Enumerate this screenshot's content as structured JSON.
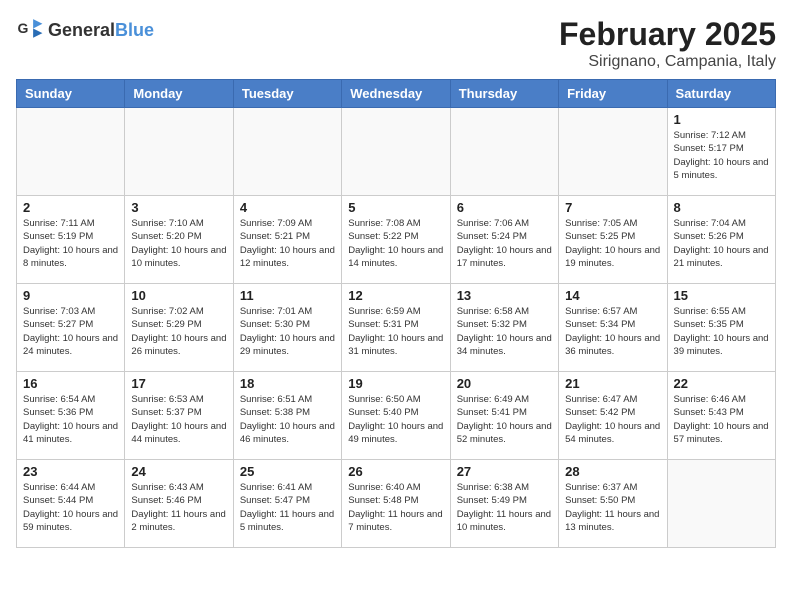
{
  "logo": {
    "general": "General",
    "blue": "Blue"
  },
  "title": "February 2025",
  "subtitle": "Sirignano, Campania, Italy",
  "weekdays": [
    "Sunday",
    "Monday",
    "Tuesday",
    "Wednesday",
    "Thursday",
    "Friday",
    "Saturday"
  ],
  "weeks": [
    [
      {
        "day": "",
        "info": ""
      },
      {
        "day": "",
        "info": ""
      },
      {
        "day": "",
        "info": ""
      },
      {
        "day": "",
        "info": ""
      },
      {
        "day": "",
        "info": ""
      },
      {
        "day": "",
        "info": ""
      },
      {
        "day": "1",
        "info": "Sunrise: 7:12 AM\nSunset: 5:17 PM\nDaylight: 10 hours and 5 minutes."
      }
    ],
    [
      {
        "day": "2",
        "info": "Sunrise: 7:11 AM\nSunset: 5:19 PM\nDaylight: 10 hours and 8 minutes."
      },
      {
        "day": "3",
        "info": "Sunrise: 7:10 AM\nSunset: 5:20 PM\nDaylight: 10 hours and 10 minutes."
      },
      {
        "day": "4",
        "info": "Sunrise: 7:09 AM\nSunset: 5:21 PM\nDaylight: 10 hours and 12 minutes."
      },
      {
        "day": "5",
        "info": "Sunrise: 7:08 AM\nSunset: 5:22 PM\nDaylight: 10 hours and 14 minutes."
      },
      {
        "day": "6",
        "info": "Sunrise: 7:06 AM\nSunset: 5:24 PM\nDaylight: 10 hours and 17 minutes."
      },
      {
        "day": "7",
        "info": "Sunrise: 7:05 AM\nSunset: 5:25 PM\nDaylight: 10 hours and 19 minutes."
      },
      {
        "day": "8",
        "info": "Sunrise: 7:04 AM\nSunset: 5:26 PM\nDaylight: 10 hours and 21 minutes."
      }
    ],
    [
      {
        "day": "9",
        "info": "Sunrise: 7:03 AM\nSunset: 5:27 PM\nDaylight: 10 hours and 24 minutes."
      },
      {
        "day": "10",
        "info": "Sunrise: 7:02 AM\nSunset: 5:29 PM\nDaylight: 10 hours and 26 minutes."
      },
      {
        "day": "11",
        "info": "Sunrise: 7:01 AM\nSunset: 5:30 PM\nDaylight: 10 hours and 29 minutes."
      },
      {
        "day": "12",
        "info": "Sunrise: 6:59 AM\nSunset: 5:31 PM\nDaylight: 10 hours and 31 minutes."
      },
      {
        "day": "13",
        "info": "Sunrise: 6:58 AM\nSunset: 5:32 PM\nDaylight: 10 hours and 34 minutes."
      },
      {
        "day": "14",
        "info": "Sunrise: 6:57 AM\nSunset: 5:34 PM\nDaylight: 10 hours and 36 minutes."
      },
      {
        "day": "15",
        "info": "Sunrise: 6:55 AM\nSunset: 5:35 PM\nDaylight: 10 hours and 39 minutes."
      }
    ],
    [
      {
        "day": "16",
        "info": "Sunrise: 6:54 AM\nSunset: 5:36 PM\nDaylight: 10 hours and 41 minutes."
      },
      {
        "day": "17",
        "info": "Sunrise: 6:53 AM\nSunset: 5:37 PM\nDaylight: 10 hours and 44 minutes."
      },
      {
        "day": "18",
        "info": "Sunrise: 6:51 AM\nSunset: 5:38 PM\nDaylight: 10 hours and 46 minutes."
      },
      {
        "day": "19",
        "info": "Sunrise: 6:50 AM\nSunset: 5:40 PM\nDaylight: 10 hours and 49 minutes."
      },
      {
        "day": "20",
        "info": "Sunrise: 6:49 AM\nSunset: 5:41 PM\nDaylight: 10 hours and 52 minutes."
      },
      {
        "day": "21",
        "info": "Sunrise: 6:47 AM\nSunset: 5:42 PM\nDaylight: 10 hours and 54 minutes."
      },
      {
        "day": "22",
        "info": "Sunrise: 6:46 AM\nSunset: 5:43 PM\nDaylight: 10 hours and 57 minutes."
      }
    ],
    [
      {
        "day": "23",
        "info": "Sunrise: 6:44 AM\nSunset: 5:44 PM\nDaylight: 10 hours and 59 minutes."
      },
      {
        "day": "24",
        "info": "Sunrise: 6:43 AM\nSunset: 5:46 PM\nDaylight: 11 hours and 2 minutes."
      },
      {
        "day": "25",
        "info": "Sunrise: 6:41 AM\nSunset: 5:47 PM\nDaylight: 11 hours and 5 minutes."
      },
      {
        "day": "26",
        "info": "Sunrise: 6:40 AM\nSunset: 5:48 PM\nDaylight: 11 hours and 7 minutes."
      },
      {
        "day": "27",
        "info": "Sunrise: 6:38 AM\nSunset: 5:49 PM\nDaylight: 11 hours and 10 minutes."
      },
      {
        "day": "28",
        "info": "Sunrise: 6:37 AM\nSunset: 5:50 PM\nDaylight: 11 hours and 13 minutes."
      },
      {
        "day": "",
        "info": ""
      }
    ]
  ]
}
